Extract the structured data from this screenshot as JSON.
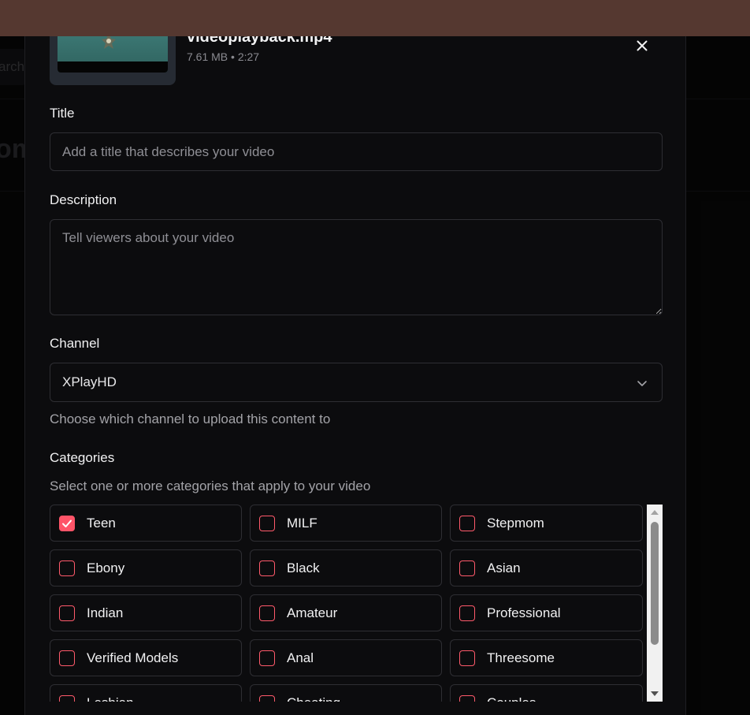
{
  "background": {
    "search_partial": "arch",
    "heading_partial": "om"
  },
  "upload": {
    "file_name": "videoplayback.mp4",
    "file_meta": "7.61 MB • 2:27"
  },
  "form": {
    "title_label": "Title",
    "title_placeholder": "Add a title that describes your video",
    "description_label": "Description",
    "description_placeholder": "Tell viewers about your video",
    "channel_label": "Channel",
    "channel_value": "XPlayHD",
    "channel_hint": "Choose which channel to upload this content to",
    "categories_label": "Categories",
    "categories_hint": "Select one or more categories that apply to your video"
  },
  "categories": [
    {
      "label": "Teen",
      "checked": true
    },
    {
      "label": "MILF",
      "checked": false
    },
    {
      "label": "Stepmom",
      "checked": false
    },
    {
      "label": "Ebony",
      "checked": false
    },
    {
      "label": "Black",
      "checked": false
    },
    {
      "label": "Asian",
      "checked": false
    },
    {
      "label": "Indian",
      "checked": false
    },
    {
      "label": "Amateur",
      "checked": false
    },
    {
      "label": "Professional",
      "checked": false
    },
    {
      "label": "Verified Models",
      "checked": false
    },
    {
      "label": "Anal",
      "checked": false
    },
    {
      "label": "Threesome",
      "checked": false
    },
    {
      "label": "Lesbian",
      "checked": false
    },
    {
      "label": "Cheating",
      "checked": false
    },
    {
      "label": "Couples",
      "checked": false
    }
  ],
  "colors": {
    "accent": "#ff5468",
    "top_bar": "#553830",
    "modal_bg": "#0c0c0e"
  }
}
